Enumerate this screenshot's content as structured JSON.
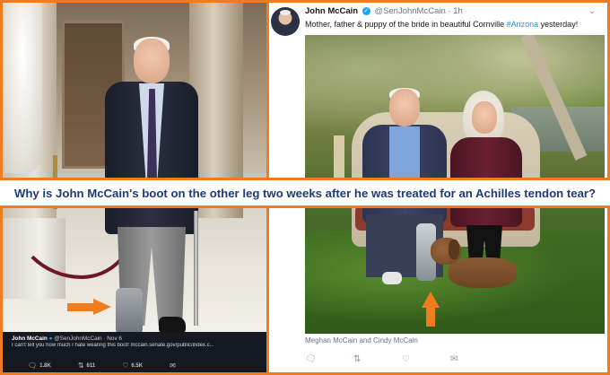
{
  "banner": {
    "title": "Why is John McCain's boot on the other leg two weeks after he was treated for an Achilles tendon tear?",
    "border_color": "#f07c1d",
    "text_color": "#1f3a78"
  },
  "left_tweet": {
    "author": "John McCain",
    "handle": "@SenJohnMcCain",
    "date": "· Nov 6",
    "text": "I can't tell you how much I hate wearing this boot! mccain.senate.gov/public/index.c...",
    "actions": {
      "reply_count": "1.8K",
      "retweet_count": "611",
      "like_count": "6.5K"
    }
  },
  "right_tweet": {
    "author": "John McCain",
    "handle": "@SenJohnMcCain · 1h",
    "text_before": "Mother, father & puppy of the bride in beautiful Cornville ",
    "hashtag": "#Arizona",
    "text_after": " yesterday!",
    "caption": "Meghan McCain and Cindy McCain",
    "caret": "⌄"
  },
  "icons": {
    "reply": "reply-icon",
    "retweet": "retweet-icon",
    "like": "heart-icon",
    "message": "envelope-icon",
    "verified": "verified-badge-icon",
    "arrow_left_photo": "arrow-right-icon",
    "arrow_right_photo": "arrow-up-icon"
  }
}
